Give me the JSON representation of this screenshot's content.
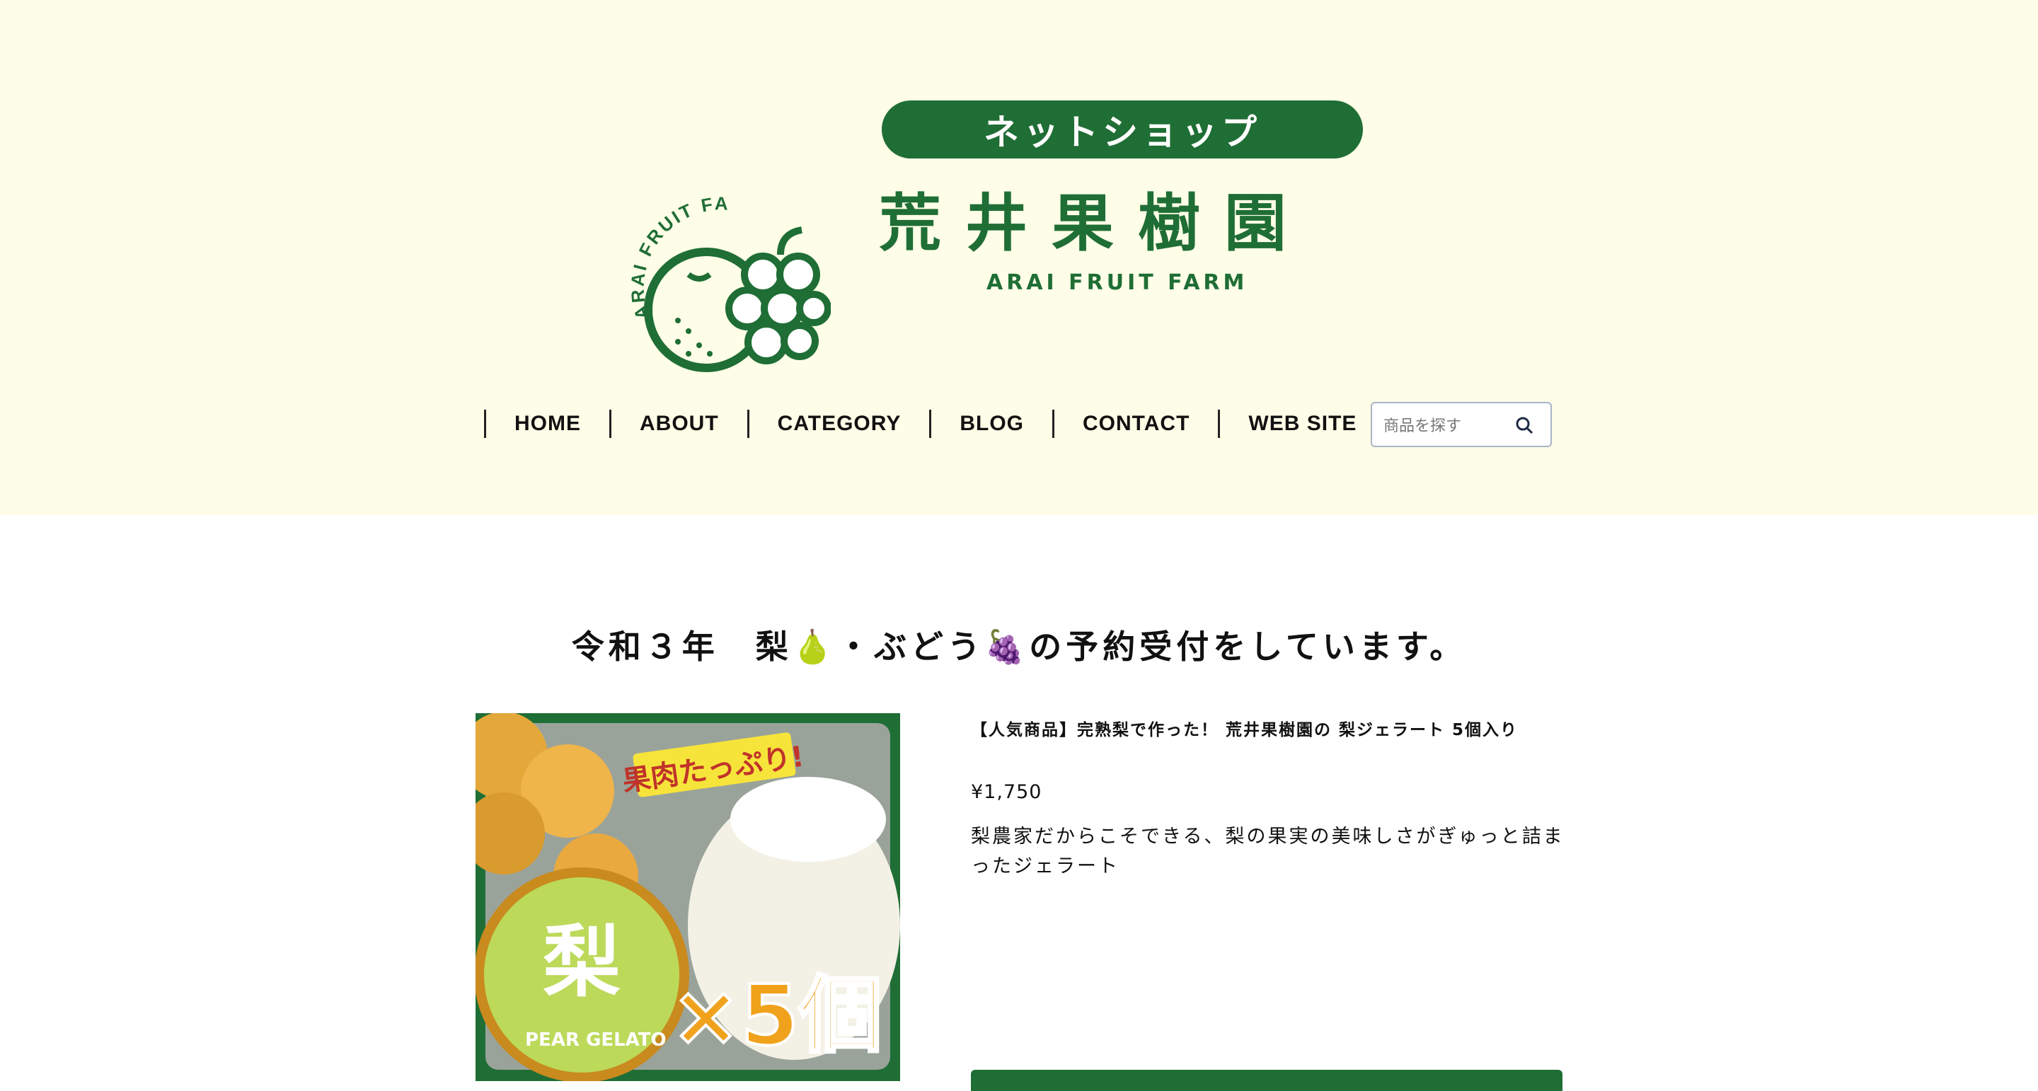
{
  "header": {
    "logo_pill": "ネットショップ",
    "logo_title": "荒井果樹園",
    "logo_subtitle": "ARAI FRUIT FARM",
    "logo_ring_text": "ARAI FRUIT FARM"
  },
  "nav": {
    "items": [
      "HOME",
      "ABOUT",
      "CATEGORY",
      "BLOG",
      "CONTACT",
      "WEB SITE"
    ]
  },
  "search": {
    "placeholder": "商品を探す"
  },
  "main": {
    "headline": "令和３年　梨🍐・ぶどう🍇の予約受付をしています。",
    "product": {
      "title": "【人気商品】完熟梨で作った！ 荒井果樹園の 梨ジェラート 5個入り",
      "price": "¥1,750",
      "description": "梨農家だからこそできる、梨の果実の美味しさがぎゅっと詰まったジェラート",
      "image_badge": "果肉たっぷり!",
      "image_count": "×5個",
      "image_lid_label": "PEAR GELATO",
      "image_lid_char": "梨"
    }
  },
  "colors": {
    "brand_green": "#1f6e35",
    "header_bg": "#fefde7"
  }
}
